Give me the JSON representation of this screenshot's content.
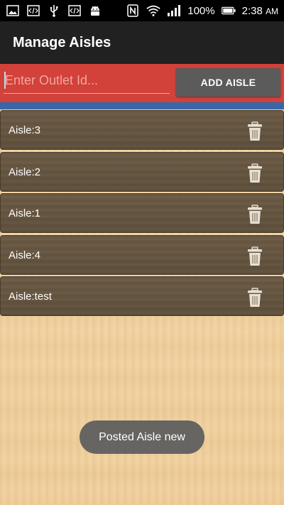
{
  "status_bar": {
    "battery_percent": "100%",
    "time": "2:38",
    "ampm": "AM",
    "icons_left": [
      "gallery-icon",
      "code-icon",
      "usb-icon",
      "code-icon",
      "android-icon"
    ],
    "icons_right": [
      "nfc-icon",
      "wifi-icon",
      "signal-icon",
      "battery-icon"
    ]
  },
  "app_bar": {
    "title": "Manage Aisles"
  },
  "form": {
    "outlet_placeholder": "Enter Outlet Id...",
    "outlet_value": "",
    "add_button_label": "ADD AISLE"
  },
  "aisles": [
    {
      "label": "Aisle:3"
    },
    {
      "label": "Aisle:2"
    },
    {
      "label": "Aisle:1"
    },
    {
      "label": "Aisle:4"
    },
    {
      "label": "Aisle:test"
    }
  ],
  "toast": {
    "message": "Posted Aisle new"
  },
  "colors": {
    "app_bar": "#212121",
    "input_row": "#d2413a",
    "strip": "#3a66a7",
    "button": "#5b5b5b",
    "list_item": "#5e4f3b"
  }
}
